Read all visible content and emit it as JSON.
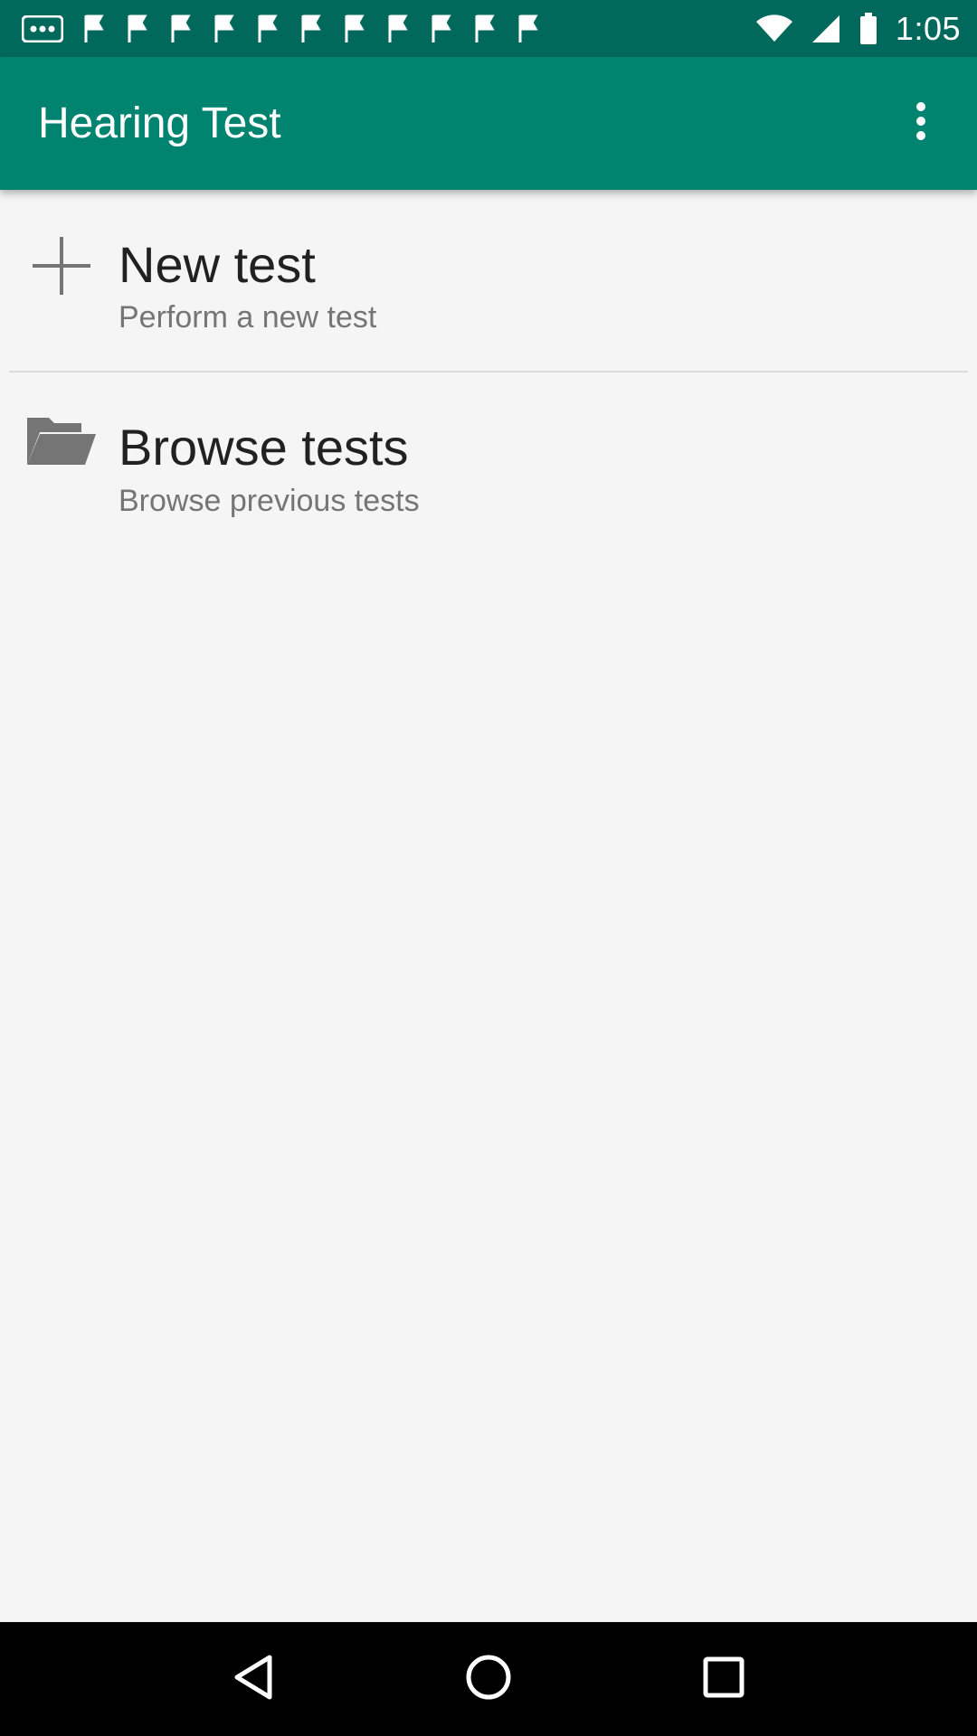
{
  "status_bar": {
    "time": "1:05",
    "notification_icons": [
      "more-icon",
      "flag-icon",
      "flag-icon",
      "flag-icon",
      "flag-icon",
      "flag-icon",
      "flag-icon",
      "flag-icon",
      "flag-icon",
      "flag-icon",
      "flag-icon",
      "flag-icon"
    ],
    "status_icons": [
      "wifi-icon",
      "signal-icon",
      "battery-icon"
    ]
  },
  "app_bar": {
    "title": "Hearing Test",
    "overflow_icon": "more-vert-icon"
  },
  "menu": {
    "items": [
      {
        "icon": "plus-icon",
        "title": "New test",
        "subtitle": "Perform a new test"
      },
      {
        "icon": "folder-icon",
        "title": "Browse tests",
        "subtitle": "Browse previous tests"
      }
    ]
  },
  "nav_bar": {
    "buttons": [
      "back-icon",
      "home-icon",
      "recents-icon"
    ]
  },
  "colors": {
    "status_bar": "#00695c",
    "app_bar": "#00836f",
    "background": "#f5f5f5",
    "title_text": "#212121",
    "subtitle_text": "#757575"
  }
}
